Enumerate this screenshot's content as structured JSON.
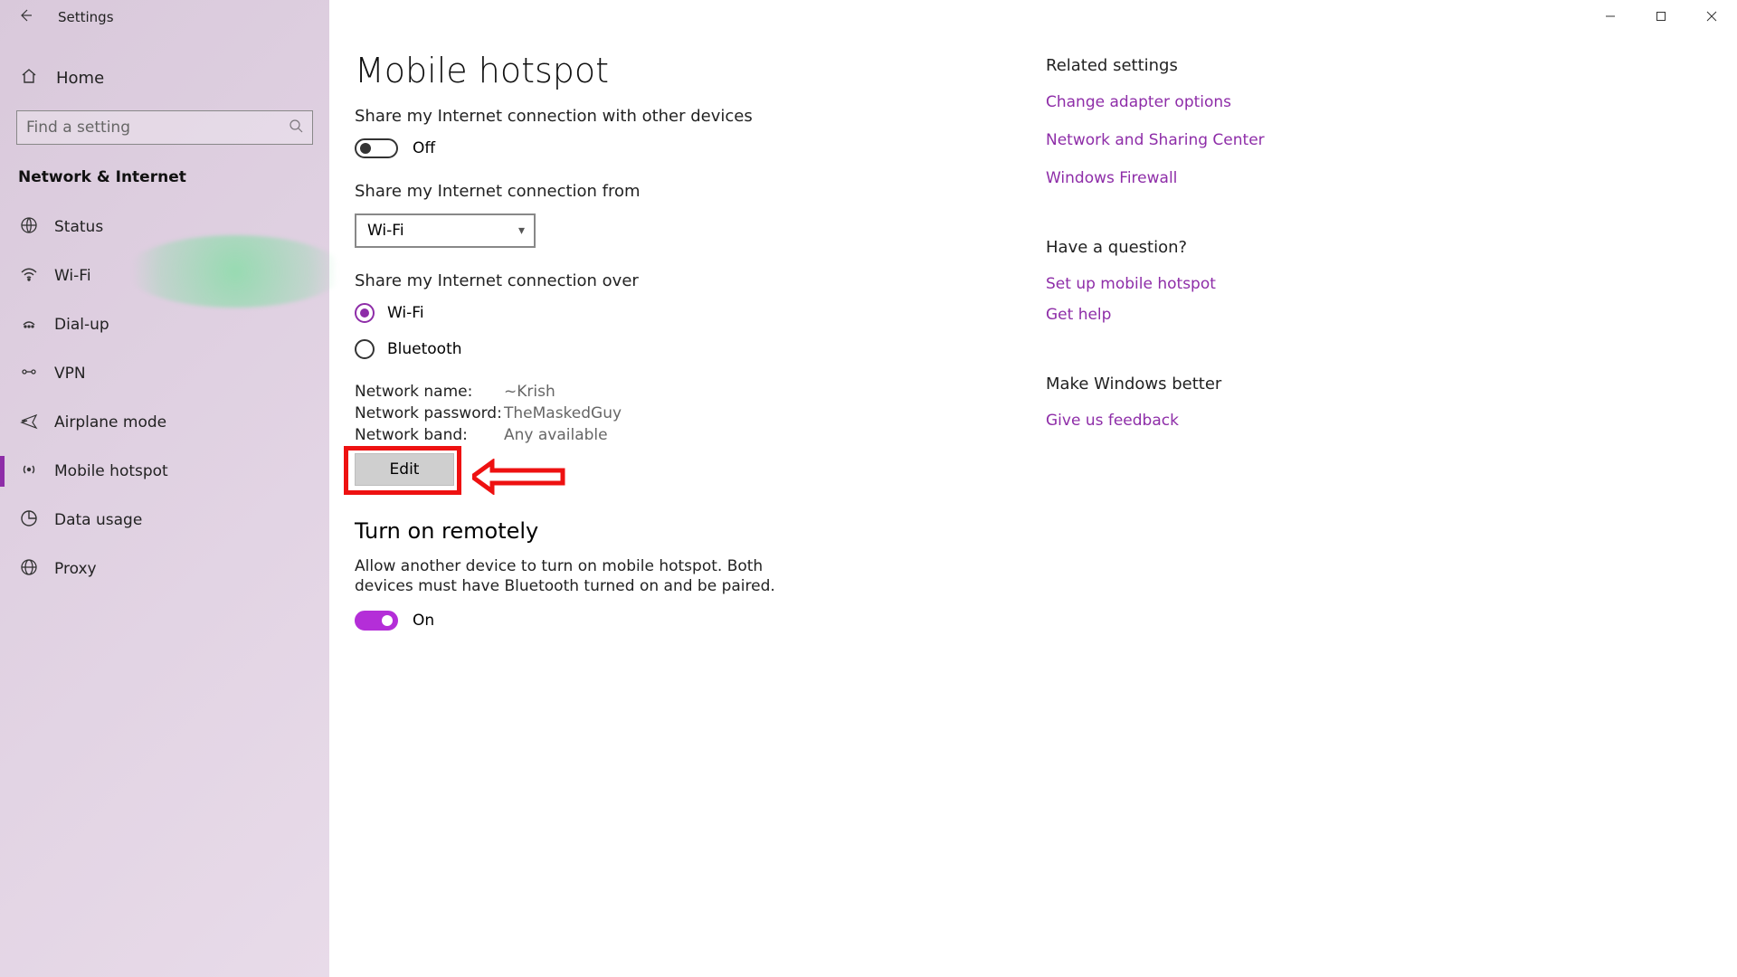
{
  "titlebar": {
    "title": "Settings"
  },
  "sidebar": {
    "home_label": "Home",
    "search_placeholder": "Find a setting",
    "section_header": "Network & Internet",
    "items": [
      {
        "label": "Status",
        "icon": "status"
      },
      {
        "label": "Wi-Fi",
        "icon": "wifi"
      },
      {
        "label": "Dial-up",
        "icon": "dialup"
      },
      {
        "label": "VPN",
        "icon": "vpn"
      },
      {
        "label": "Airplane mode",
        "icon": "airplane"
      },
      {
        "label": "Mobile hotspot",
        "icon": "hotspot"
      },
      {
        "label": "Data usage",
        "icon": "datausage"
      },
      {
        "label": "Proxy",
        "icon": "proxy"
      }
    ],
    "selected_index": 5
  },
  "main": {
    "page_title": "Mobile hotspot",
    "share_label": "Share my Internet connection with other devices",
    "share_toggle": {
      "on": false,
      "text": "Off"
    },
    "share_from_label": "Share my Internet connection from",
    "share_from_value": "Wi-Fi",
    "share_over_label": "Share my Internet connection over",
    "share_over_options": [
      {
        "label": "Wi-Fi",
        "checked": true
      },
      {
        "label": "Bluetooth",
        "checked": false
      }
    ],
    "network": {
      "name_label": "Network name:",
      "name_value": "~Krish",
      "password_label": "Network password:",
      "password_value": "TheMaskedGuy",
      "band_label": "Network band:",
      "band_value": "Any available"
    },
    "edit_label": "Edit",
    "remote": {
      "heading": "Turn on remotely",
      "desc": "Allow another device to turn on mobile hotspot. Both devices must have Bluetooth turned on and be paired.",
      "toggle": {
        "on": true,
        "text": "On"
      }
    }
  },
  "right": {
    "related": {
      "title": "Related settings",
      "links": [
        "Change adapter options",
        "Network and Sharing Center",
        "Windows Firewall"
      ]
    },
    "question": {
      "title": "Have a question?",
      "links": [
        "Set up mobile hotspot",
        "Get help"
      ]
    },
    "better": {
      "title": "Make Windows better",
      "links": [
        "Give us feedback"
      ]
    }
  }
}
